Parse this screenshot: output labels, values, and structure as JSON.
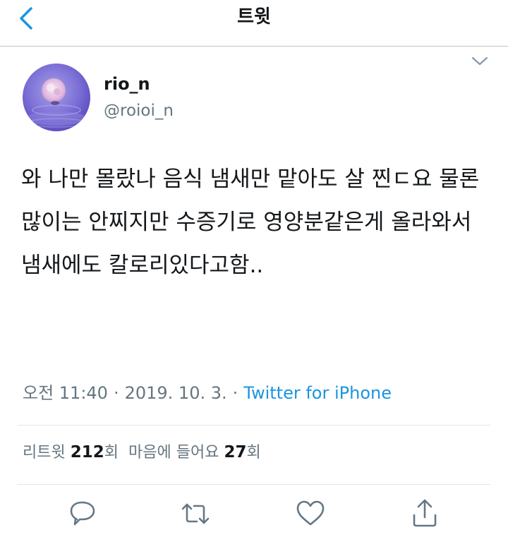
{
  "header": {
    "title": "트윗",
    "back_icon": "chevron-left-icon"
  },
  "tweet": {
    "author": {
      "display_name": "rio_n",
      "handle": "@roioi_n"
    },
    "text": "와 나만 몰랐나 음식 냄새만 맡아도 살 찐ㄷ요 물론 많이는 안찌지만 수증기로 영양분같은게 올라와서 냄새에도 칼로리있다고함..",
    "time": "오전 11:40",
    "date": "2019. 10. 3.",
    "separator": "·",
    "source": "Twitter for iPhone",
    "stats": {
      "retweets_label": "리트윗",
      "retweets_count": "212",
      "retweets_unit": "회",
      "likes_label": "마음에 들어요",
      "likes_count": "27",
      "likes_unit": "회"
    }
  },
  "actions": [
    {
      "icon": "reply-icon"
    },
    {
      "icon": "retweet-icon"
    },
    {
      "icon": "like-heart-icon"
    },
    {
      "icon": "share-icon"
    }
  ],
  "colors": {
    "accent": "#1b95e0",
    "text_primary": "#14171a",
    "text_secondary": "#66757f",
    "divider": "#e1e6ea"
  }
}
